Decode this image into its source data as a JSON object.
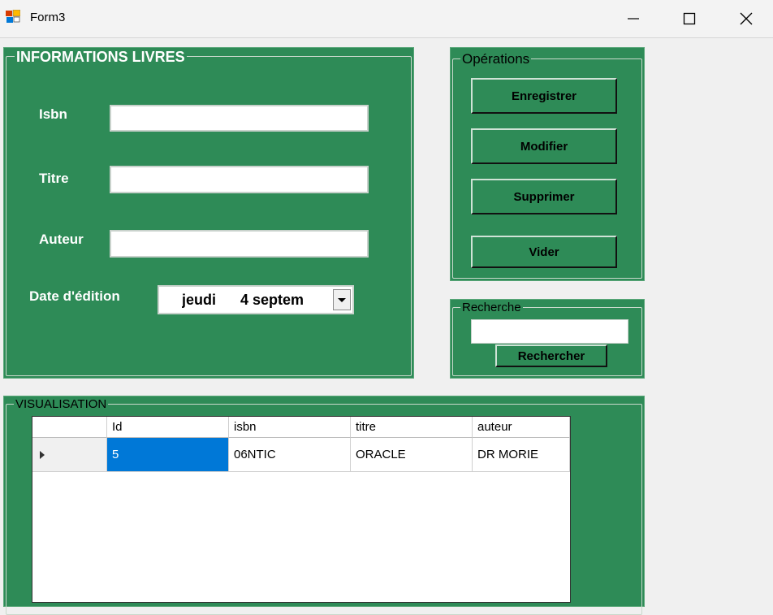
{
  "window": {
    "title": "Form3"
  },
  "info": {
    "title": "INFORMATIONS LIVRES",
    "isbn_label": "Isbn",
    "titre_label": "Titre",
    "auteur_label": "Auteur",
    "date_label": "Date d'édition",
    "isbn_value": "",
    "titre_value": "",
    "auteur_value": "",
    "date_value": "jeudi      4 septem"
  },
  "operations": {
    "title": "Opérations",
    "enregistrer": "Enregistrer",
    "modifier": "Modifier",
    "supprimer": "Supprimer",
    "vider": "Vider"
  },
  "recherche": {
    "title": "Recherche",
    "value": "",
    "button": "Rechercher"
  },
  "visualisation": {
    "title": "VISUALISATION",
    "columns": [
      "Id",
      "isbn",
      "titre",
      "auteur"
    ],
    "rows": [
      {
        "id": "5",
        "isbn": "06NTIC",
        "titre": "ORACLE",
        "auteur": "DR MORIE"
      }
    ]
  },
  "colors": {
    "panel": "#2e8b57",
    "selection": "#0078d7"
  }
}
